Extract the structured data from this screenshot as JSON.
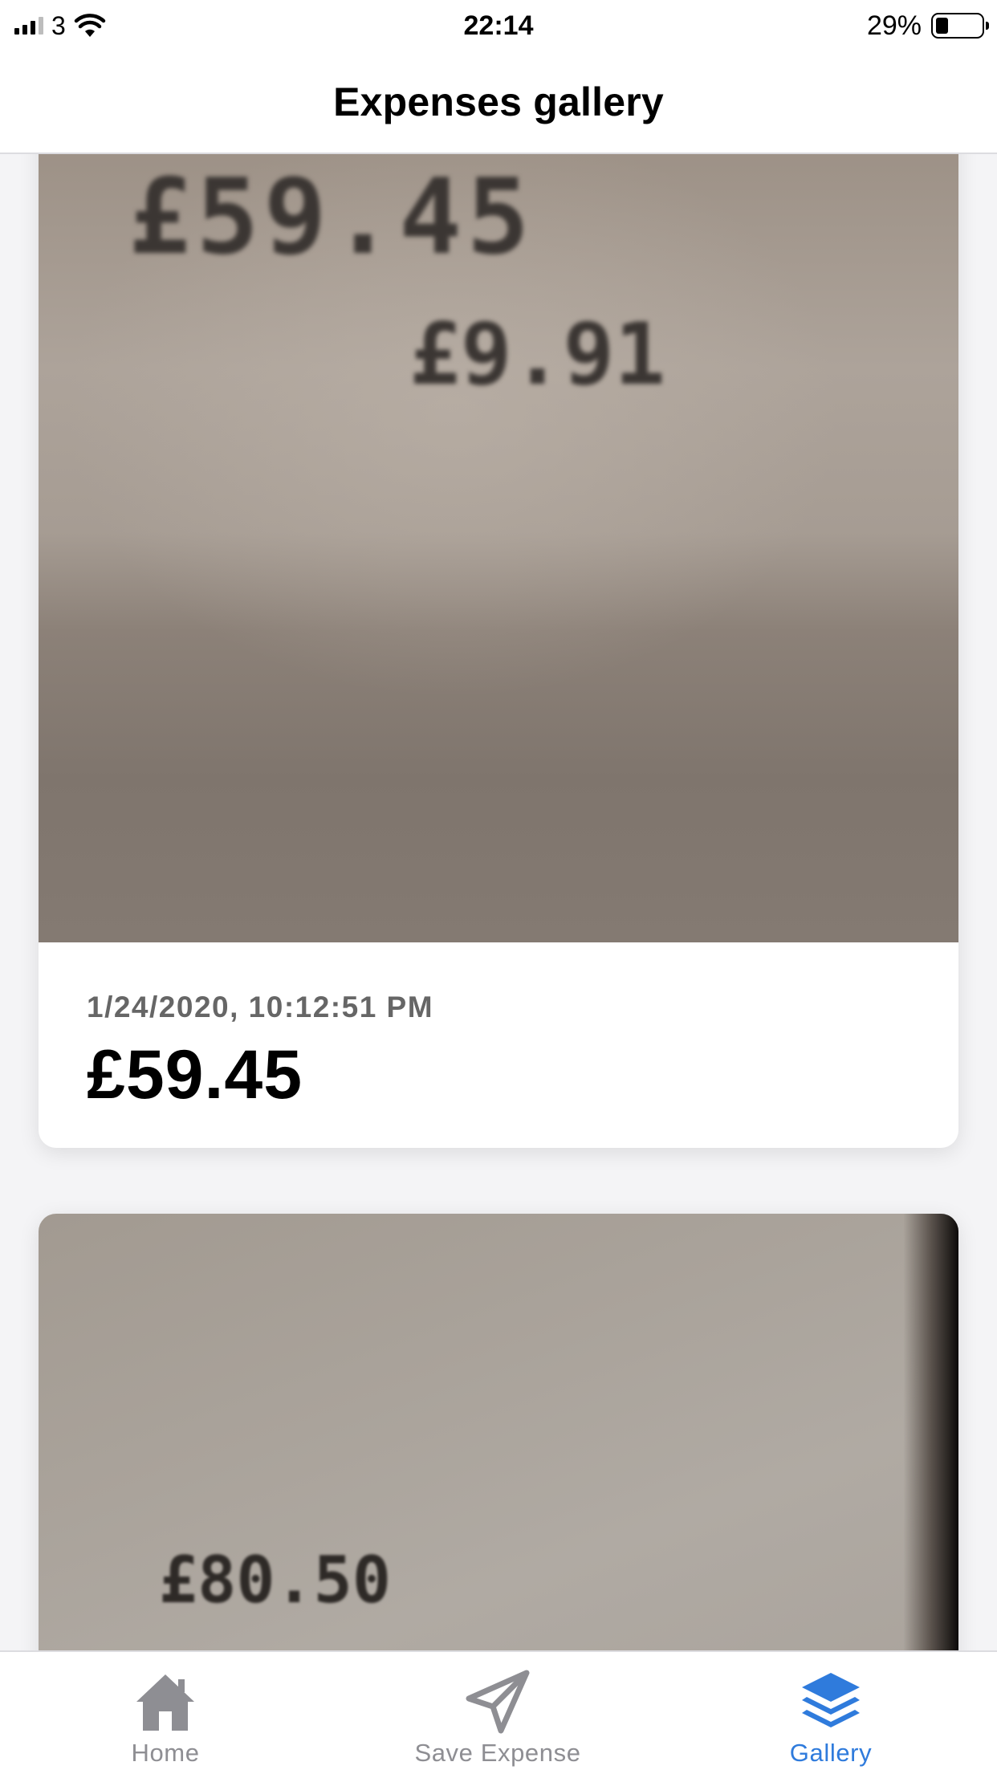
{
  "status_bar": {
    "carrier": "3",
    "time": "22:14",
    "battery_percent": "29%",
    "battery_level": 0.29,
    "signal_bars_active": 3,
    "signal_bars_total": 4
  },
  "header": {
    "title": "Expenses gallery"
  },
  "expenses": [
    {
      "receipt_text_lines": [
        "£59.45",
        "£9.91"
      ],
      "date": "1/24/2020, 10:12:51 PM",
      "amount": "£59.45"
    },
    {
      "receipt_text_lines": [
        "£80.50"
      ]
    }
  ],
  "tab_bar": {
    "tabs": [
      {
        "label": "Home",
        "icon": "home-icon",
        "active": false
      },
      {
        "label": "Save Expense",
        "icon": "paper-plane-icon",
        "active": false
      },
      {
        "label": "Gallery",
        "icon": "layers-icon",
        "active": true
      }
    ],
    "active_color": "#2f7bdc",
    "inactive_color": "#8e8e93"
  }
}
